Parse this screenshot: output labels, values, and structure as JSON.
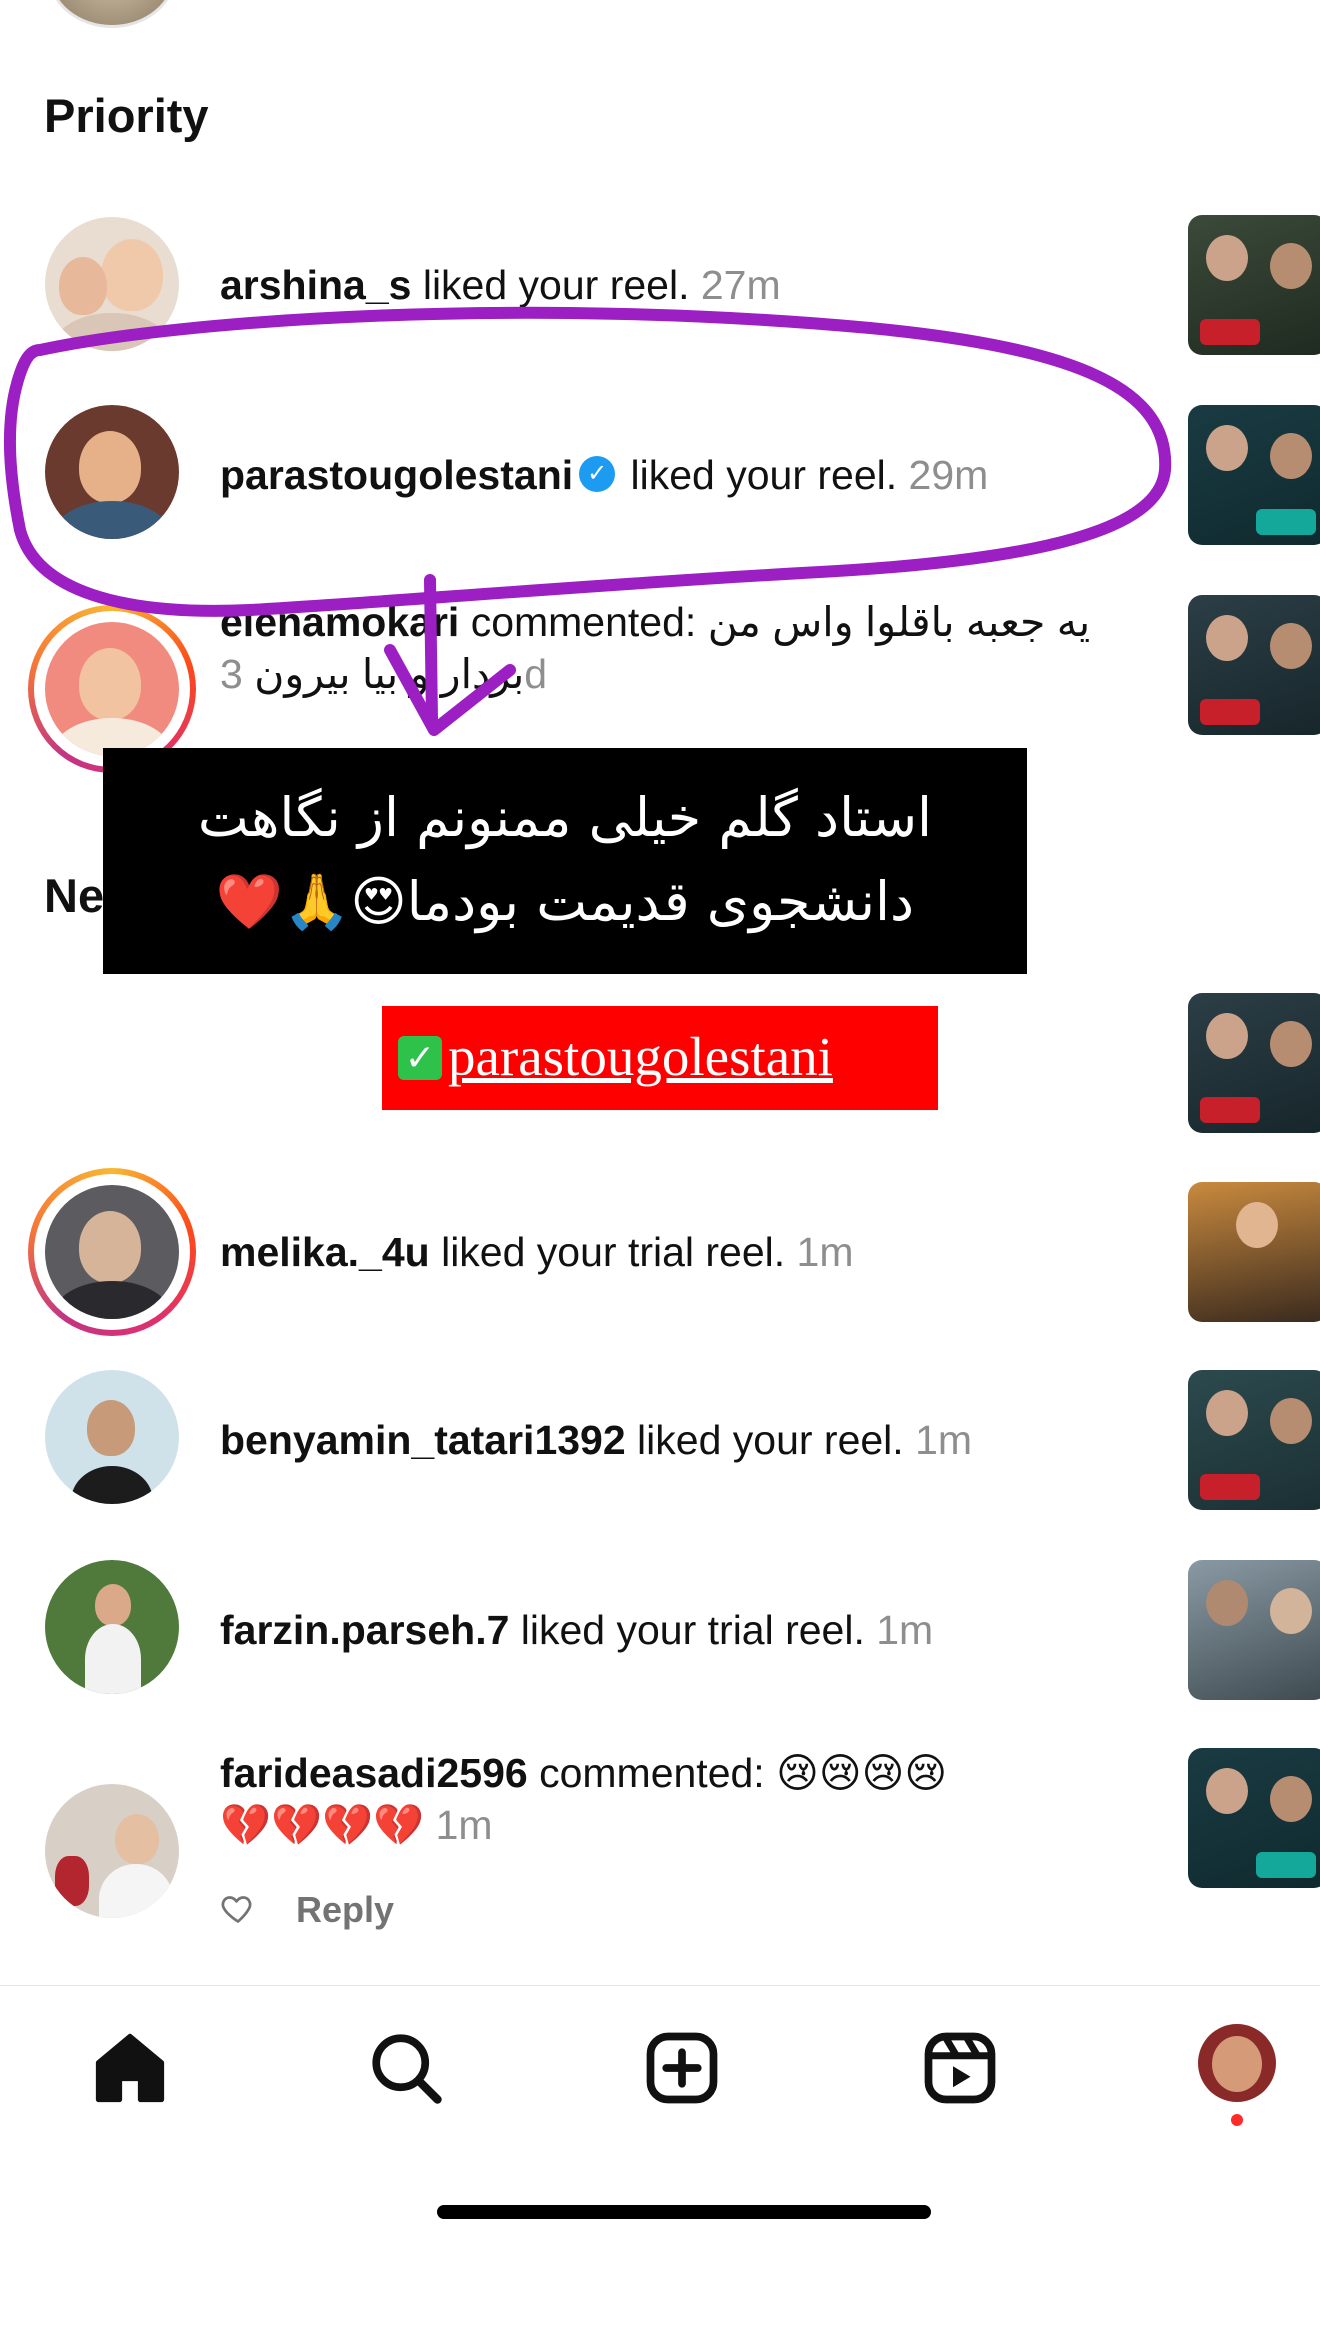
{
  "section_priority": "Priority",
  "section_new_partial": "Ne",
  "notifications_priority": [
    {
      "username": "arshina_s",
      "action": " liked your reel. ",
      "time": "27m"
    },
    {
      "username": "parastougolestani",
      "action": " liked your reel. ",
      "time": "29m",
      "verified": true
    },
    {
      "username": "elenamokari",
      "action": " commented: ",
      "comment_line1": "یه جعبه باقلوا واس من",
      "comment_line2": "بردار و بیا بیرون",
      "time": "3d"
    }
  ],
  "notifications_new": [
    {
      "username": "melika._4u",
      "action": " liked your trial reel. ",
      "time": "1m"
    },
    {
      "username": "benyamin_tatari1392",
      "action": " liked your reel. ",
      "time": "1m"
    },
    {
      "username": "farzin.parseh.7",
      "action": " liked your trial reel. ",
      "time": "1m"
    },
    {
      "username": "farideasadi2596",
      "action": " commented: ",
      "comment_emojis_1": "😢😢😢😢",
      "comment_emojis_2": "💔💔💔💔",
      "time": "1m",
      "reply_label": "Reply"
    }
  ],
  "overlay_caption": {
    "line1": "استاد گلم خیلی ممنونم از نگاهت",
    "line2": "دانشجوی قدیمت بودما😍🙏❤️"
  },
  "overlay_tag": {
    "check": "✓",
    "handle": "parastougolestani"
  },
  "colors": {
    "annotation_stroke": "#9b1fc2",
    "verified": "#1d9bf0",
    "tag_background": "#ff0000",
    "story_ring": "#e1306c",
    "time_gray": "#8e8e8e"
  },
  "nav": {
    "items": [
      "home-icon",
      "search-icon",
      "create-icon",
      "reels-icon",
      "profile-avatar"
    ],
    "active": "home-icon"
  }
}
